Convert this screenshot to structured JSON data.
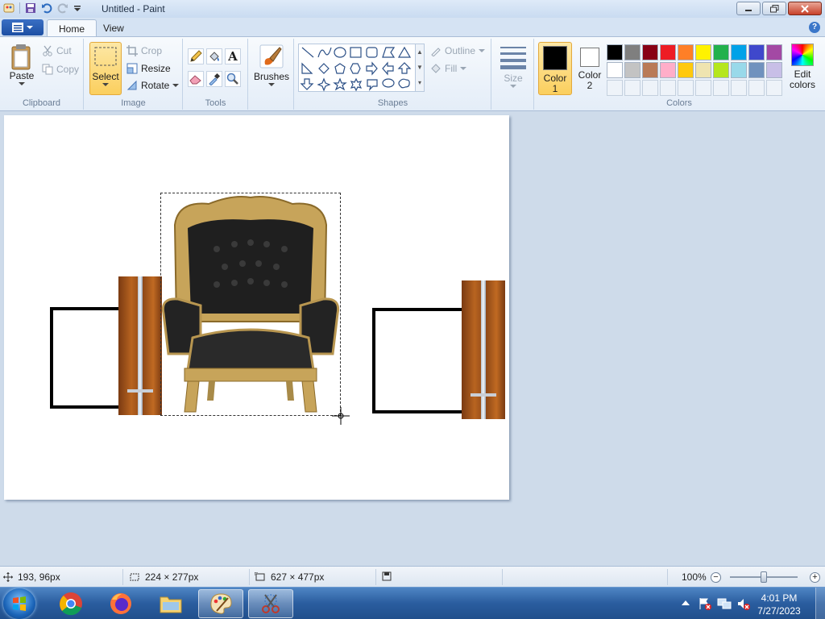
{
  "window": {
    "title": "Untitled - Paint"
  },
  "tabs": {
    "home": "Home",
    "view": "View"
  },
  "clipboard": {
    "paste": "Paste",
    "cut": "Cut",
    "copy": "Copy",
    "group": "Clipboard"
  },
  "image": {
    "select": "Select",
    "crop": "Crop",
    "resize": "Resize",
    "rotate": "Rotate",
    "group": "Image"
  },
  "tools": {
    "group": "Tools"
  },
  "brushes": {
    "label": "Brushes"
  },
  "shapes": {
    "outline": "Outline",
    "fill": "Fill",
    "group": "Shapes"
  },
  "size": {
    "label": "Size"
  },
  "colors": {
    "color1_label": "Color",
    "color1_num": "1",
    "color2_label": "Color",
    "color2_num": "2",
    "edit_label_1": "Edit",
    "edit_label_2": "colors",
    "group": "Colors",
    "color1": "#000000",
    "color2": "#ffffff",
    "palette_row1": [
      "#000000",
      "#7f7f7f",
      "#880015",
      "#ed1c24",
      "#ff7f27",
      "#fff200",
      "#22b14c",
      "#00a2e8",
      "#3f48cc",
      "#a349a4"
    ],
    "palette_row2": [
      "#ffffff",
      "#c3c3c3",
      "#b97a57",
      "#ffaec9",
      "#ffc90e",
      "#efe4b0",
      "#b5e61d",
      "#99d9ea",
      "#7092be",
      "#c8bfe7"
    ]
  },
  "status": {
    "cursor_pos": "193, 96px",
    "selection_size": "224 × 277px",
    "image_size": "627 × 477px",
    "zoom": "100%",
    "zoom_level": 0.5
  },
  "taskbar": {
    "time": "4:01 PM",
    "date": "7/27/2023"
  }
}
